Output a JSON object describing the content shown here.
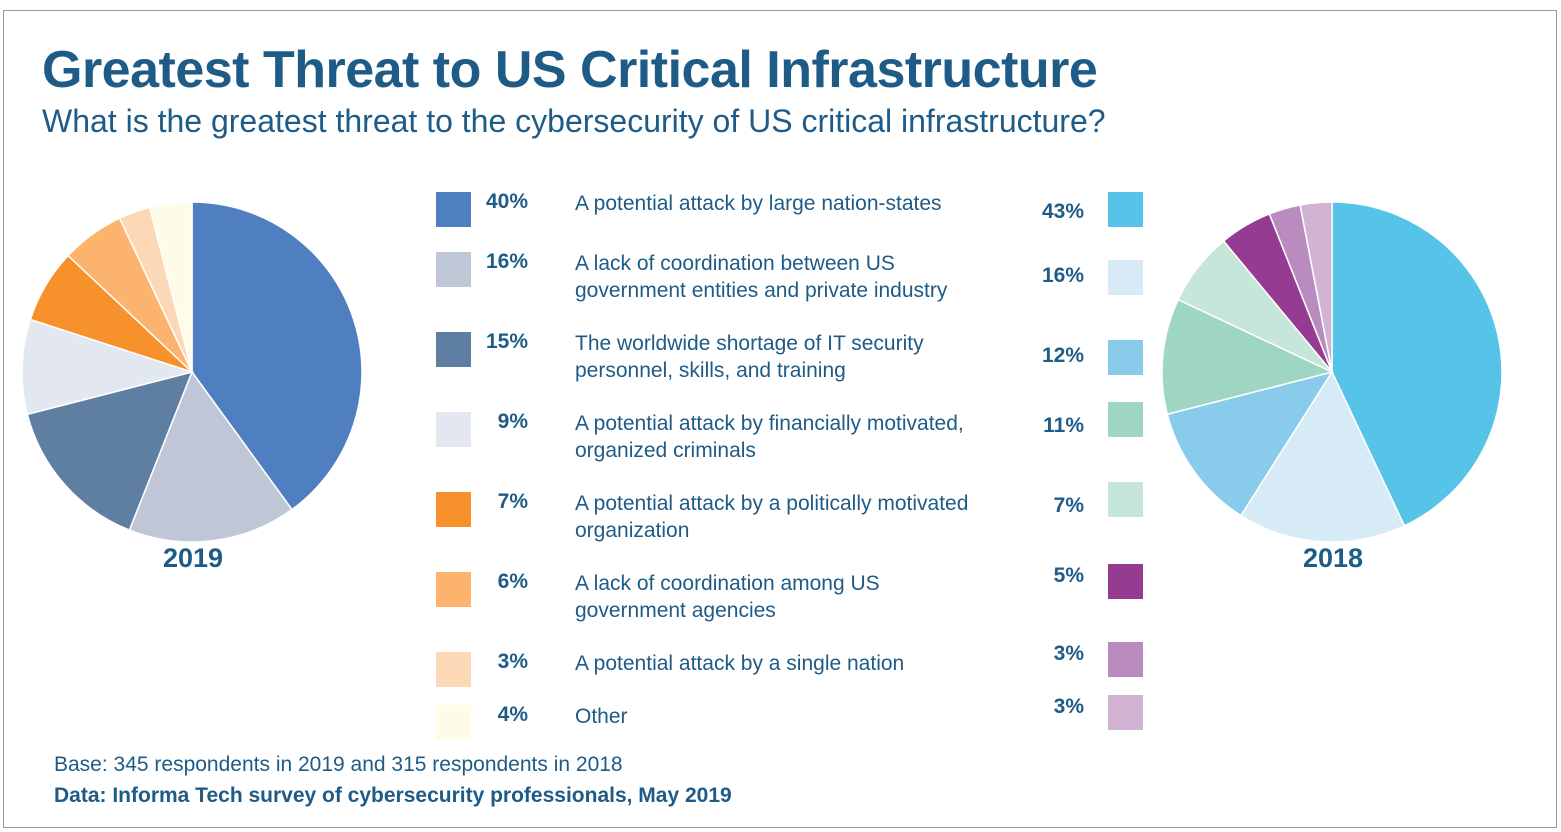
{
  "chart_data": {
    "type": "pie",
    "title": "Greatest Threat to US Critical Infrastructure",
    "subtitle": "What is the greatest threat to the cybersecurity of US critical infrastructure?",
    "categories": [
      "A potential attack by large nation-states",
      "A lack of coordination between US\ngovernment entities and private industry",
      "The worldwide shortage of IT security\npersonnel, skills, and training",
      "A potential attack by financially motivated,\norganized criminals",
      "A potential attack by a politically motivated\n organization",
      "A lack of coordination among US\ngovernment agencies",
      "A potential attack by a single nation",
      "Other"
    ],
    "series": [
      {
        "name": "2019",
        "values": [
          40,
          16,
          15,
          9,
          7,
          6,
          3,
          4
        ],
        "labels": [
          "40%",
          "16%",
          "15%",
          "9%",
          "7%",
          "6%",
          "3%",
          "4%"
        ],
        "colors": [
          "#4f7fc0",
          "#bfc7d6",
          "#5e7fa2",
          "#e3e8f0",
          "#f7912c",
          "#fbb36e",
          "#fdd8b6",
          "#fefbe6"
        ]
      },
      {
        "name": "2018",
        "values": [
          43,
          16,
          12,
          11,
          7,
          5,
          3,
          3
        ],
        "labels": [
          "43%",
          "16%",
          "12%",
          "11%",
          "7%",
          "5%",
          "3%",
          "3%"
        ],
        "colors": [
          "#56c3e8",
          "#d7ebf6",
          "#88cbea",
          "#9fd6c3",
          "#c6e6da",
          "#953c92",
          "#b98bbf",
          "#d3b3d4"
        ]
      }
    ],
    "legend": "center",
    "notes": [
      "Base: 345 respondents in 2019 and 315 respondents in 2018",
      "Data: Informa Tech survey of cybersecurity professionals, May 2019"
    ]
  }
}
